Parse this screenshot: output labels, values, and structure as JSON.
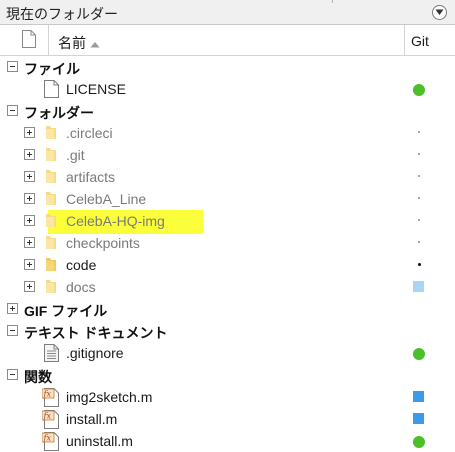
{
  "panel": {
    "title": "現在のフォルダー"
  },
  "columns": {
    "name": "名前",
    "git": "Git"
  },
  "colors": {
    "highlight": "#fbff3a",
    "git_clean": "#4cbe2a",
    "git_modified": "#3d9ae8",
    "git_untracked": "#a8d4f6"
  },
  "groups": {
    "files": {
      "label": "ファイル",
      "items": [
        {
          "name": "LICENSE",
          "icon": "document-icon",
          "git": "clean"
        }
      ]
    },
    "folders": {
      "label": "フォルダー",
      "items": [
        {
          "name": ".circleci",
          "icon": "folder-icon",
          "git": "dot"
        },
        {
          "name": ".git",
          "icon": "folder-icon",
          "git": "dot"
        },
        {
          "name": "artifacts",
          "icon": "folder-icon",
          "git": "dot"
        },
        {
          "name": "CelebA_Line",
          "icon": "folder-icon",
          "git": "dot"
        },
        {
          "name": "CelebA-HQ-img",
          "icon": "folder-icon",
          "git": "dot",
          "highlighted": true
        },
        {
          "name": "checkpoints",
          "icon": "folder-icon",
          "git": "dot"
        },
        {
          "name": "code",
          "icon": "folder-icon",
          "git": "dot-dark"
        },
        {
          "name": "docs",
          "icon": "folder-icon",
          "git": "untracked"
        }
      ]
    },
    "gif": {
      "label": "GIF ファイル"
    },
    "text": {
      "label": "テキスト ドキュメント",
      "items": [
        {
          "name": ".gitignore",
          "icon": "text-file-icon",
          "git": "clean"
        }
      ]
    },
    "functions": {
      "label": "関数",
      "items": [
        {
          "name": "img2sketch.m",
          "icon": "function-file-icon",
          "git": "modified"
        },
        {
          "name": "install.m",
          "icon": "function-file-icon",
          "git": "modified"
        },
        {
          "name": "uninstall.m",
          "icon": "function-file-icon",
          "git": "clean"
        }
      ]
    }
  }
}
